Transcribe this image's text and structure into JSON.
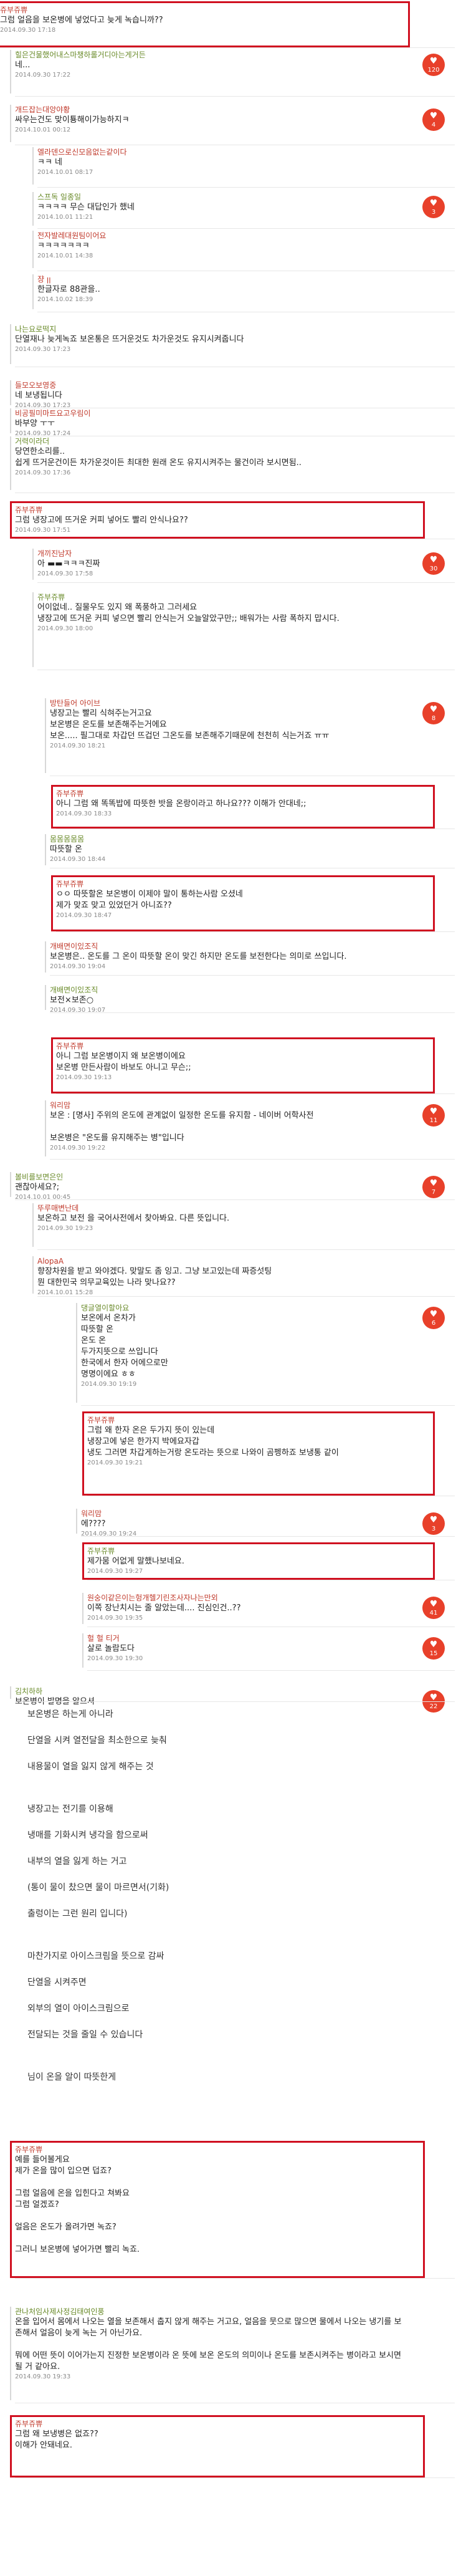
{
  "comments": [
    {
      "nick": "쥬부쥬쀼",
      "body": "그럼 얼음을 보온병에 넣었다고 늦게 녹습니까??",
      "ts": "2014.09.30 17:18",
      "boxed": true
    },
    {
      "nick": "힐은건물했어내스마챙하롤거디아는게거든",
      "body": "네...",
      "ts": "2014.09.30 17:22",
      "vote": "120"
    },
    {
      "nick": "개드잡는대앙야황",
      "body": "싸우는건도 맞이툥해이가능하지ㅋ",
      "ts": "2014.10.01 00:12",
      "vote": "4"
    },
    {
      "nick": "엘라덴으로신모음없는같이다",
      "body": "ㅋㅋ 네",
      "ts": "2014.10.01 08:17"
    },
    {
      "nick": "스프독 일종일",
      "body": "ㅋㅋㅋㅋ 무슨 대답인가 했네",
      "ts": "2014.10.01 11:21",
      "vote": "3"
    },
    {
      "nick": "전자발레대원팀이어요",
      "body": "ㅋㅋㅋㅋㅋㅋㅋ",
      "ts": "2014.10.01 14:38"
    },
    {
      "nick": "쟝 ꞁꞁ",
      "body": "한글자로 88관을..",
      "ts": "2014.10.02 18:39"
    },
    {
      "nick": "나는요로떡지",
      "body": "단열재나 늦게녹죠 보온통은 뜨거운것도 차가운것도 유지시켜줍니다",
      "ts": "2014.09.30 17:23"
    },
    {
      "nick": "들모오보영중",
      "body": "네 보냉됩니다",
      "ts": "2014.09.30 17:23"
    },
    {
      "nick": "비공필미마트요고우림이",
      "body": "바부양 ㅜㅜ",
      "ts": "2014.09.30 17:24"
    },
    {
      "nick": "거력이라더",
      "body": "당연한소리를..\n쉽게 뜨거운건이든 차가운것이든 최대한 원래 온도 유지시켜주는 물건이라 보시면됨..",
      "ts": "2014.09.30 17:36"
    },
    {
      "nick": "쥬부쥬쀼",
      "body": "그럼 냉장고에 뜨거운 커피 넣어도 빨리 안식나요??",
      "ts": "2014.09.30 17:51",
      "boxed": true
    },
    {
      "nick": "개끼진남자",
      "body": "아 ▬▬ㅋㅋㅋ진짜",
      "ts": "2014.09.30 17:58",
      "vote": "30"
    },
    {
      "nick": "쥬부쥬쀼",
      "body": "어이없네.. 질물우도 있지 왜 폭풍하고 그러세요\n냉장고에 뜨거운 커피 넣으면 빨리 안식는거 오늘알았구만;; 배워가는 사람 폭하지 맙시다.",
      "ts": "2014.09.30 18:00"
    },
    {
      "nick": "방탄들어 아이브",
      "body": "냉장고는 빨리 식혀주는거고요\n보온병은 온도를 보존해주는거에요\n보온..... 필그대로 차갑던 뜨겁던 그온도를 보존해주기때문에 천천히 식는거죠 ㅠㅠ",
      "ts": "2014.09.30 18:21",
      "vote": "8"
    },
    {
      "nick": "쥬부쥬쀼",
      "body": "아니 그럼 왜 똑똑밥에 따뜻한 밧을 온랑이라고 하나요??? 이해가 안대네;;",
      "ts": "2014.09.30 18:33",
      "boxed": true
    },
    {
      "nick": "몸몸몸몸몸",
      "body": "따뜻할 온",
      "ts": "2014.09.30 18:44"
    },
    {
      "nick": "쥬부쥬쀼",
      "body": "ㅇㅇ 따뜻할온 보온병이 이제야 말이 통하는사람 오셨네\n제가 맞죠 맞고 있었던거 아니죠??",
      "ts": "2014.09.30 18:47",
      "boxed": true
    },
    {
      "nick": "개배면이있조직",
      "body": "보온병은.. 온도를 그 온이 따뜻할 온이 맞긴 하지만 온도를 보전한다는 의미로 쓰입니다.",
      "ts": "2014.09.30 19:04"
    },
    {
      "nick": "개배면이있조직",
      "body": "보전×보존○",
      "ts": "2014.09.30 19:07"
    },
    {
      "nick": "쥬부쥬쀼",
      "body": "아니 그럼 보온병이지 왜 보온병이에요\n보온병 만든사람이 바보도 아니고 무슨;;",
      "ts": "2014.09.30 19:13",
      "boxed": true
    },
    {
      "nick": "워리맘",
      "body": "보온 : [명사] 주위의 온도에 관계없이 일정한 온도를 유지함 - 네이버 어학사전\n\n보온병은 \"온도를 유지해주는 병\"입니다",
      "ts": "2014.09.30 19:22",
      "vote": "11"
    },
    {
      "nick": "볼비를보면은인",
      "body": "괜찮아세요?;",
      "ts": "2014.10.01 00:45",
      "vote": "7"
    },
    {
      "nick": "뚜루매변난데",
      "body": "보온하고 보전 을 국어사전에서 찾아봐요. 다른 뜻입니다.",
      "ts": "2014.09.30 19:23"
    },
    {
      "nick": "AlopaA",
      "body": "향장차원을 받고 와야겠다. 맞말도 좀 잉고. 그냥 보고있는데 짜증섯팅\n뭔 대한민국 의무교육있는 나라 맞나요??",
      "ts": "2014.10.01 15:28"
    },
    {
      "nick": "댕글열이할아요",
      "body": "보온에서 온차가\n따뜻할 온\n온도 온\n두가지뜻으로 쓰입니다\n한국에서 한자 어에으로만\n명명이에요 ㅎㅎ",
      "ts": "2014.09.30 19:19",
      "vote": "6"
    },
    {
      "nick": "쥬부쥬쀼",
      "body": "그럼 왜 한자 온은 두가지 뜻이 있는데\n냉장고에 넣은 한가지 박에요자갑\n냉도 그러면 차갑게하는거랑 온도라는 뜻으로 나와이 곰펭하죠 보냉통 같이",
      "ts": "2014.09.30 19:21",
      "boxed": true
    },
    {
      "nick": "워리맘",
      "body": "에????",
      "ts": "2014.09.30 19:24",
      "vote": "3"
    },
    {
      "nick": "쥬부쥬쀼",
      "body": "제가뭄 어없게 말했나보네요.",
      "ts": "2014.09.30 19:27",
      "boxed": true
    },
    {
      "nick": "원숭이같은이는헝개헬기린조사자나는만외",
      "body": "이쪽 장난치시는 줄 알았는데.... 진심인건..??",
      "ts": "2014.09.30 19:35",
      "vote": "41"
    },
    {
      "nick": "헐 헐 티거",
      "body": "살로 놀람도다",
      "ts": "2014.09.30 19:30",
      "vote": "15"
    },
    {
      "nick": "김치하하",
      "body": "보온병이 발명을 알으셔",
      "ts": "",
      "vote": "22"
    }
  ],
  "longreply": {
    "lines": [
      "보온병은 하는게 아니라",
      "단열을 시켜 열전달을 최소한으로 늦춰",
      "내용물이 열을 잃지 않게 해주는 것",
      "",
      "냉장고는 전기를 이용해",
      "냉매를 기화시켜 냉각을 함으로써",
      "내부의 열을 잃게 하는 거고",
      "(통이 물이 찼으면 물이 마르면서(기화)",
      "출렁이는 그런 원리 입니다)",
      "",
      "마찬가지로 아이스크림을 뜻으로 감싸",
      "단열을 시켜주면",
      "외부의 열이 아이스크림으로",
      "전달되는 것을 줄일 수 있습니다",
      "",
      "님이 온을 알이 따뜻한게"
    ]
  },
  "tail": [
    {
      "nick": "쥬부쥬쀼",
      "body": "예를 들어볼게요\n제가 온을 많이 입으면 덥죠?\n\n그럼 얼음에 온을 입힌다고 쳐봐요\n그럼 얼겠죠?\n\n얼음은 온도가 올려가면 녹죠?\n\n그러니 보온병에 넣어가면 빨리 녹죠.",
      "ts": "",
      "boxed": true
    },
    {
      "nick": "관나처임사제사정김태여인풍",
      "body": "온을 입어서 몸에서 나오는 열을 보존해서 춥지 않게 해주는 거고요, 얼음을 뭇으로 많으면 물에서 나오는 냉기를 보존해서 얼음이 늦게 녹는 거 아닌가요.\n\n뭐에 어떤 뜻이 이어가는지 진정한 보온병이라 온 뜻에 보온 온도의 의미이나 온도를 보존시켜주는 병이라고 보시면 될 거 같아요.",
      "ts": "2014.09.30 19:33"
    },
    {
      "nick": "쥬부쥬쀼",
      "body": "그럼 왜 보냉병은 없죠??\n이해가 안돼네요.",
      "ts": "",
      "boxed": true
    }
  ]
}
